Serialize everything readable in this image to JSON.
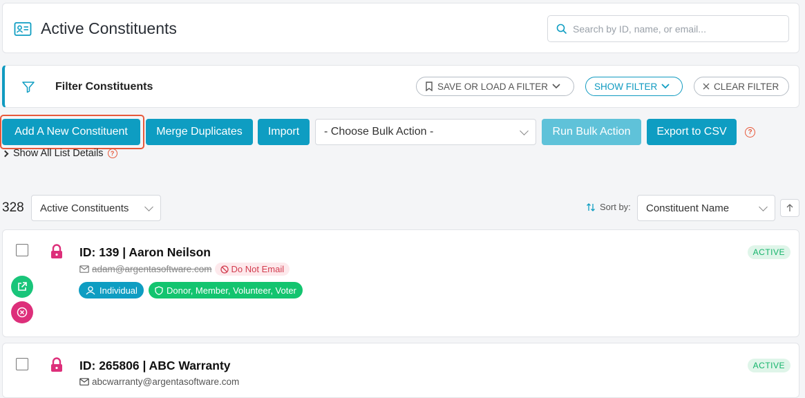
{
  "header": {
    "title": "Active Constituents",
    "title_icon": "contact-card-icon",
    "search_placeholder": "Search by ID, name, or email..."
  },
  "filter": {
    "title": "Filter Constituents",
    "save_label": "SAVE OR LOAD A FILTER",
    "show_label": "SHOW FILTER",
    "clear_label": "CLEAR FILTER"
  },
  "actions": {
    "add_label": "Add A New Constituent",
    "merge_label": "Merge Duplicates",
    "import_label": "Import",
    "bulk_selected": "- Choose Bulk Action -",
    "run_label": "Run Bulk Action",
    "export_label": "Export to CSV",
    "help_glyph": "?"
  },
  "details": {
    "label": "Show All List Details"
  },
  "list": {
    "count": "328",
    "view_selected": "Active Constituents",
    "sort_label": "Sort by:",
    "sort_selected": "Constituent Name"
  },
  "rows": [
    {
      "title": "ID: 139 | Aaron Neilson",
      "email": "adam@argentasoftware.com",
      "do_not_email": "Do Not Email",
      "type_tag": "Individual",
      "roles_tag": "Donor, Member, Volunteer, Voter",
      "status": "ACTIVE"
    },
    {
      "title": "ID: 265806 | ABC Warranty",
      "email": "abcwarranty@argentasoftware.com",
      "status": "ACTIVE"
    }
  ],
  "colors": {
    "primary": "#0e9dc2",
    "primary_disabled": "#5fc2d9",
    "highlight_outline": "#e7583a",
    "lock": "#dd2f7a",
    "active_status": "#13b36a",
    "roles_tag": "#13c46f"
  }
}
